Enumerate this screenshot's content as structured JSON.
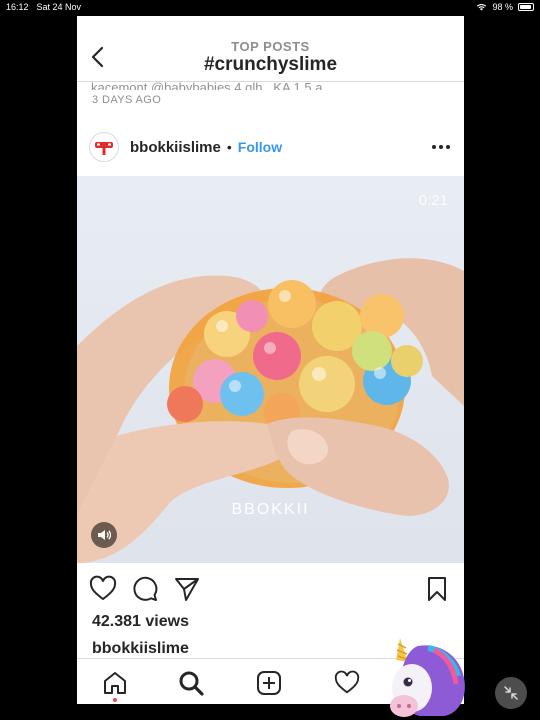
{
  "status_bar": {
    "time": "16:12",
    "date": "Sat 24 Nov",
    "battery": "98 %"
  },
  "header": {
    "subtitle": "TOP POSTS",
    "title": "#crunchyslime"
  },
  "previous_post": {
    "caption_fragment": "kacemont @babybabies 4 glh . KA 1.5 a.",
    "time_ago": "3 DAYS AGO"
  },
  "post": {
    "username": "bbokkiislime",
    "separator": "•",
    "follow_label": "Follow",
    "video_time": "0:21",
    "watermark": "BBOKKII",
    "views": "42.381 views",
    "caption_username": "bbokkiislime"
  },
  "icons": {
    "back": "chevron-left-icon",
    "more": "more-horizontal-icon",
    "sound": "speaker-icon",
    "like": "heart-icon",
    "comment": "comment-icon",
    "share": "send-icon",
    "save": "bookmark-icon",
    "tabs": [
      "home-icon",
      "search-icon",
      "add-post-icon",
      "activity-heart-icon",
      "profile-unicorn-icon"
    ]
  },
  "colors": {
    "accent": "#3897f0",
    "text": "#262626",
    "muted": "#8e8e8e",
    "notification": "#ed4956"
  }
}
